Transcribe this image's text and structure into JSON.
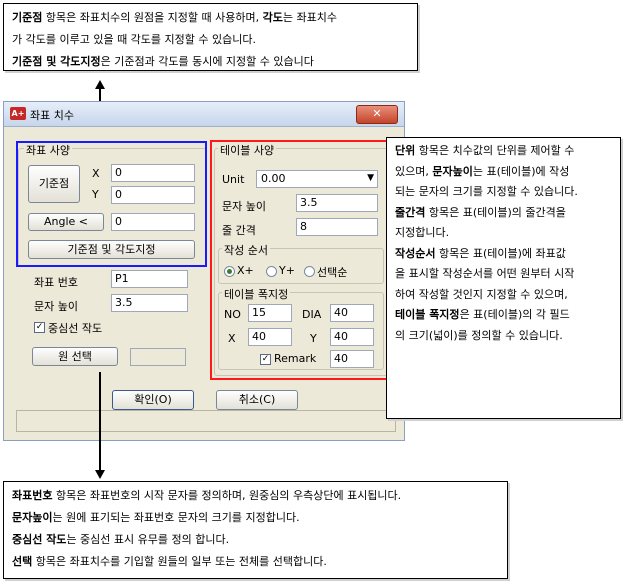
{
  "top_callout": {
    "line1_b1": "기준점",
    "line1_t1": " 항목은 좌표치수의 원점을 지정할 때 사용하며, ",
    "line1_b2": "각도",
    "line1_t2": "는 좌표치수",
    "line2": "가 각도를 이루고 있을 때 각도를 지정할 수 있습니다.",
    "line3_b": "기준점 및 각도지정",
    "line3_t": "은 기준점과 각도를 동시에 지정할 수 있습니다"
  },
  "dialog": {
    "app_icon": "A+",
    "title": "좌표 치수",
    "close_label": "✕",
    "coord_group": "좌표 사양",
    "origin_button": "기준점",
    "x_label": "X",
    "x_value": "0",
    "y_label": "Y",
    "y_value": "0",
    "angle_button": "Angle <",
    "angle_value": "0",
    "origin_angle_button": "기준점 및 각도지정",
    "coord_no_label": "좌표 번호",
    "coord_no_value": "P1",
    "text_height_label": "문자 높이",
    "text_height_value": "3.5",
    "centerline_label": "중심선 작도",
    "centerline_checked": true,
    "circle_select_button": "원 선택",
    "table_group": "테이블 사양",
    "unit_label": "Unit",
    "unit_value": "0.00",
    "t_text_height_label": "문자 높이",
    "t_text_height_value": "3.5",
    "row_gap_label": "줄 간격",
    "row_gap_value": "8",
    "order_group": "작성 순서",
    "order_options": [
      "X+",
      "Y+",
      "선택순"
    ],
    "order_selected": 0,
    "width_group": "테이블 폭지정",
    "no_label": "NO",
    "no_value": "15",
    "dia_label": "DIA",
    "dia_value": "40",
    "wx_label": "X",
    "wx_value": "40",
    "wy_label": "Y",
    "wy_value": "40",
    "remark_label": "Remark",
    "remark_checked": true,
    "remark_value": "40",
    "ok_button": "확인(O)",
    "cancel_button": "취소(C)"
  },
  "right_callout": {
    "p1_b": "단위",
    "p1_t1": " 항목은 치수값의 단위를 제어할 수",
    "p1_t2_a": "있으며, ",
    "p1_b2": "문자높이",
    "p1_t2_b": "는 표(테이블)에 작성",
    "p1_t3": "되는 문자의 크기를 지정할 수 있습니다.",
    "p2_b": "줄간격",
    "p2_t1": " 항목은 표(테이블)의 줄간격을",
    "p2_t2": "지정합니다.",
    "p3_b": "작성순서",
    "p3_t1": " 항목은 표(테이블)에 좌표값",
    "p3_t2": "을 표시할 작성순서를 어떤 원부터 시작",
    "p3_t3": "하여 작성할 것인지 지정할 수 있으며,",
    "p4_b": "테이블 폭지정",
    "p4_t1": "은 표(테이블)의 각 필드",
    "p4_t2": "의 크기(넓이)를 정의할 수 있습니다."
  },
  "bottom_callout": {
    "l1_b": "좌표번호",
    "l1_t": " 항목은 좌표번호의 시작 문자를 정의하며, 원중심의 우측상단에 표시됩니다.",
    "l2_b": "문자높이",
    "l2_t": "는 원에 표기되는 좌표번호 문자의 크기를 지정합니다.",
    "l3_b": "중심선 작도",
    "l3_t": "는 중심선 표시 유무를 정의 합니다.",
    "l4_b": "선택",
    "l4_t": " 항목은 좌표치수를 기입할 원들의 일부 또는 전체를 선택합니다."
  }
}
